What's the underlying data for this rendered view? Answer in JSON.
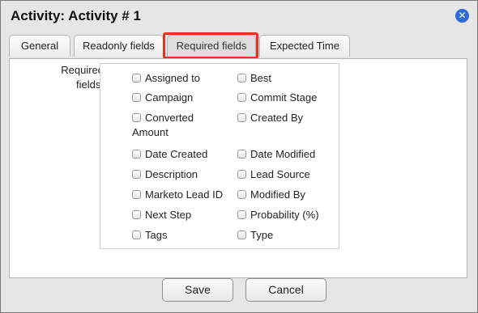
{
  "dialog": {
    "title": "Activity: Activity # 1",
    "close_icon": "close-icon"
  },
  "tabs": [
    {
      "label": "General"
    },
    {
      "label": "Readonly fields"
    },
    {
      "label": "Required fields",
      "active": true
    },
    {
      "label": "Expected Time"
    }
  ],
  "required": {
    "label": "Required fields:",
    "fields": [
      "Assigned to",
      "Best",
      "Campaign",
      "Commit Stage",
      "Converted Amount",
      "Created By",
      "Date Created",
      "Date Modified",
      "Description",
      "Lead Source",
      "Marketo Lead ID",
      "Modified By",
      "Next Step",
      "Probability (%)",
      "Tags",
      "Type"
    ]
  },
  "buttons": {
    "save": "Save",
    "cancel": "Cancel"
  },
  "colors": {
    "highlight": "#e5341c",
    "close_bg": "#2d6bd6"
  }
}
